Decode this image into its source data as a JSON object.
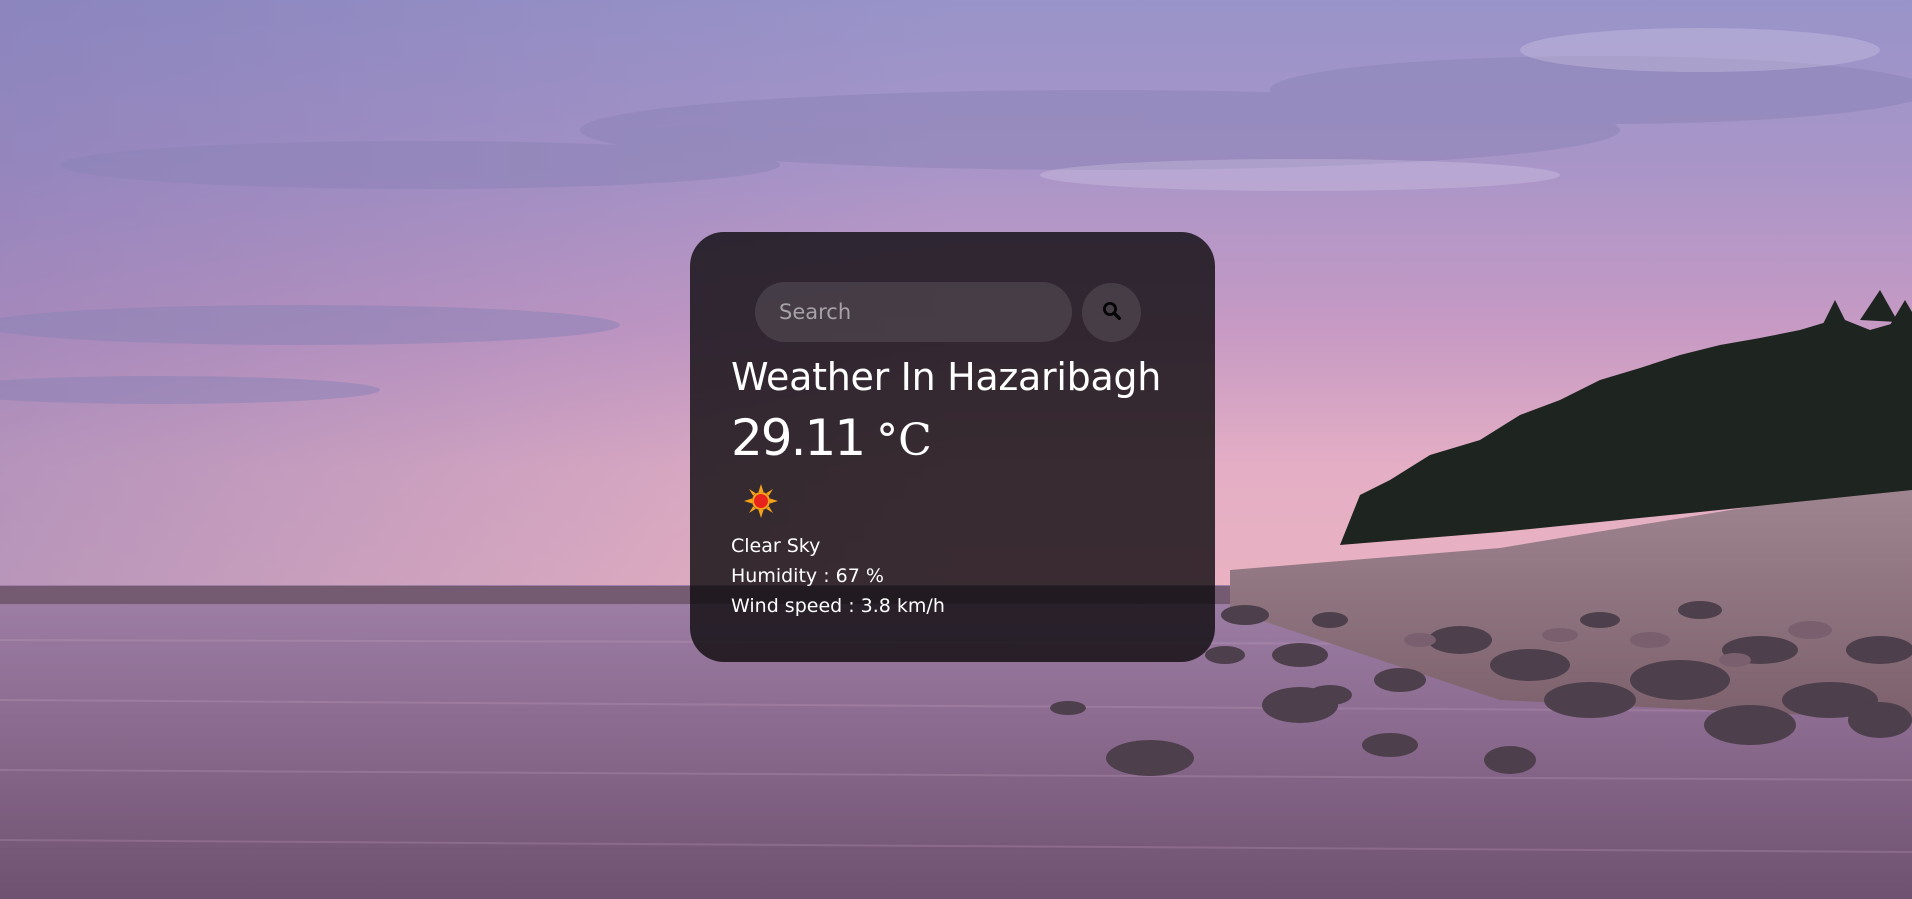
{
  "search": {
    "placeholder": "Search",
    "value": ""
  },
  "search_button": {
    "icon": "search-icon"
  },
  "weather": {
    "city_heading": "Weather In Hazaribagh",
    "temperature": "29.11",
    "unit": "°C",
    "icon": "sun-icon",
    "description": "Clear Sky",
    "humidity_text": "Humidity : 67 %",
    "wind_text": "Wind speed : 3.8 km/h"
  },
  "colors": {
    "card_background": "#0c0a0c",
    "text": "#ffffff",
    "sun_core": "#e8231c",
    "sun_rays": "#f6a21a"
  }
}
